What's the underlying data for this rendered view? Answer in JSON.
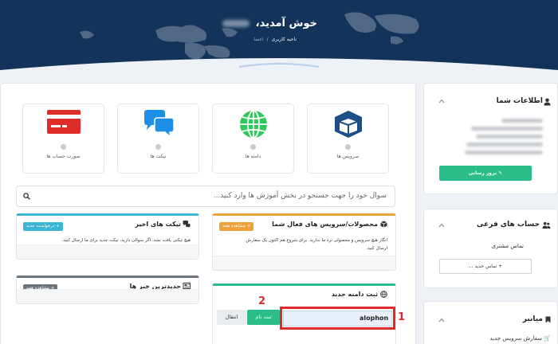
{
  "header": {
    "welcome": "خوش آمدید،",
    "breadcrumb": {
      "home": "اعضا",
      "current": "ناحیه کاربری"
    }
  },
  "tiles": [
    {
      "label": "سرویس ها",
      "icon": "box-icon",
      "color": "#1c4f8a"
    },
    {
      "label": "دامنه ها",
      "icon": "globe-icon",
      "color": "#2fc95a"
    },
    {
      "label": "تیکت ها",
      "icon": "chat-bubbles-icon",
      "color": "#1e8fe6"
    },
    {
      "label": "صورت حساب ها",
      "icon": "credit-card-icon",
      "color": "#e02b2b"
    }
  ],
  "search": {
    "placeholder": "سوال خود را جهت جستجو در بخش آموزش ها وارد کنید..."
  },
  "panels": {
    "services": {
      "title": "محصولات/سرویس های فعال شما",
      "badge": "+ مشاهده همه",
      "text_line1": "انگار هیچ سرویس و محصولی نزد ما ندارید. برای شروع هم اکنون یک سفارش",
      "text_line2": "ارسال کنید."
    },
    "tickets": {
      "title": "تیکت های اخیر",
      "badge": "+ درخواست جدید",
      "text": "هیچ تیکتی یافت نشد. اگر سوالی دارید، تیکت جدید برای ما ارسال کنید."
    },
    "news": {
      "title": "جدیدترین خبر ها",
      "badge": "+ مشاهده همه"
    },
    "domain": {
      "title": "ثبت دامنه جدید",
      "input_value": "alophon",
      "register_label": "ثبت نام",
      "transfer_label": "انتقال"
    }
  },
  "annotations": {
    "first": "1",
    "second": "2"
  },
  "sidebar": {
    "info": {
      "title": "اطلاعات شما",
      "update_label": "بروز رسانی"
    },
    "subaccounts": {
      "title": "حساب های فرعی",
      "contact_label": "تماس مشتری",
      "new_contact_label": "+ تماس جدید ..."
    },
    "shortcuts": {
      "title": "میانبر",
      "new_order_label": "سفارش سرویس جدید"
    }
  },
  "colors": {
    "header_bg": "#13335a",
    "accent_green": "#2bbd87",
    "accent_orange": "#f0a23a",
    "accent_cyan": "#3ab5d4",
    "badge_gray": "#6c757d",
    "highlight_red": "#e02b2b"
  }
}
